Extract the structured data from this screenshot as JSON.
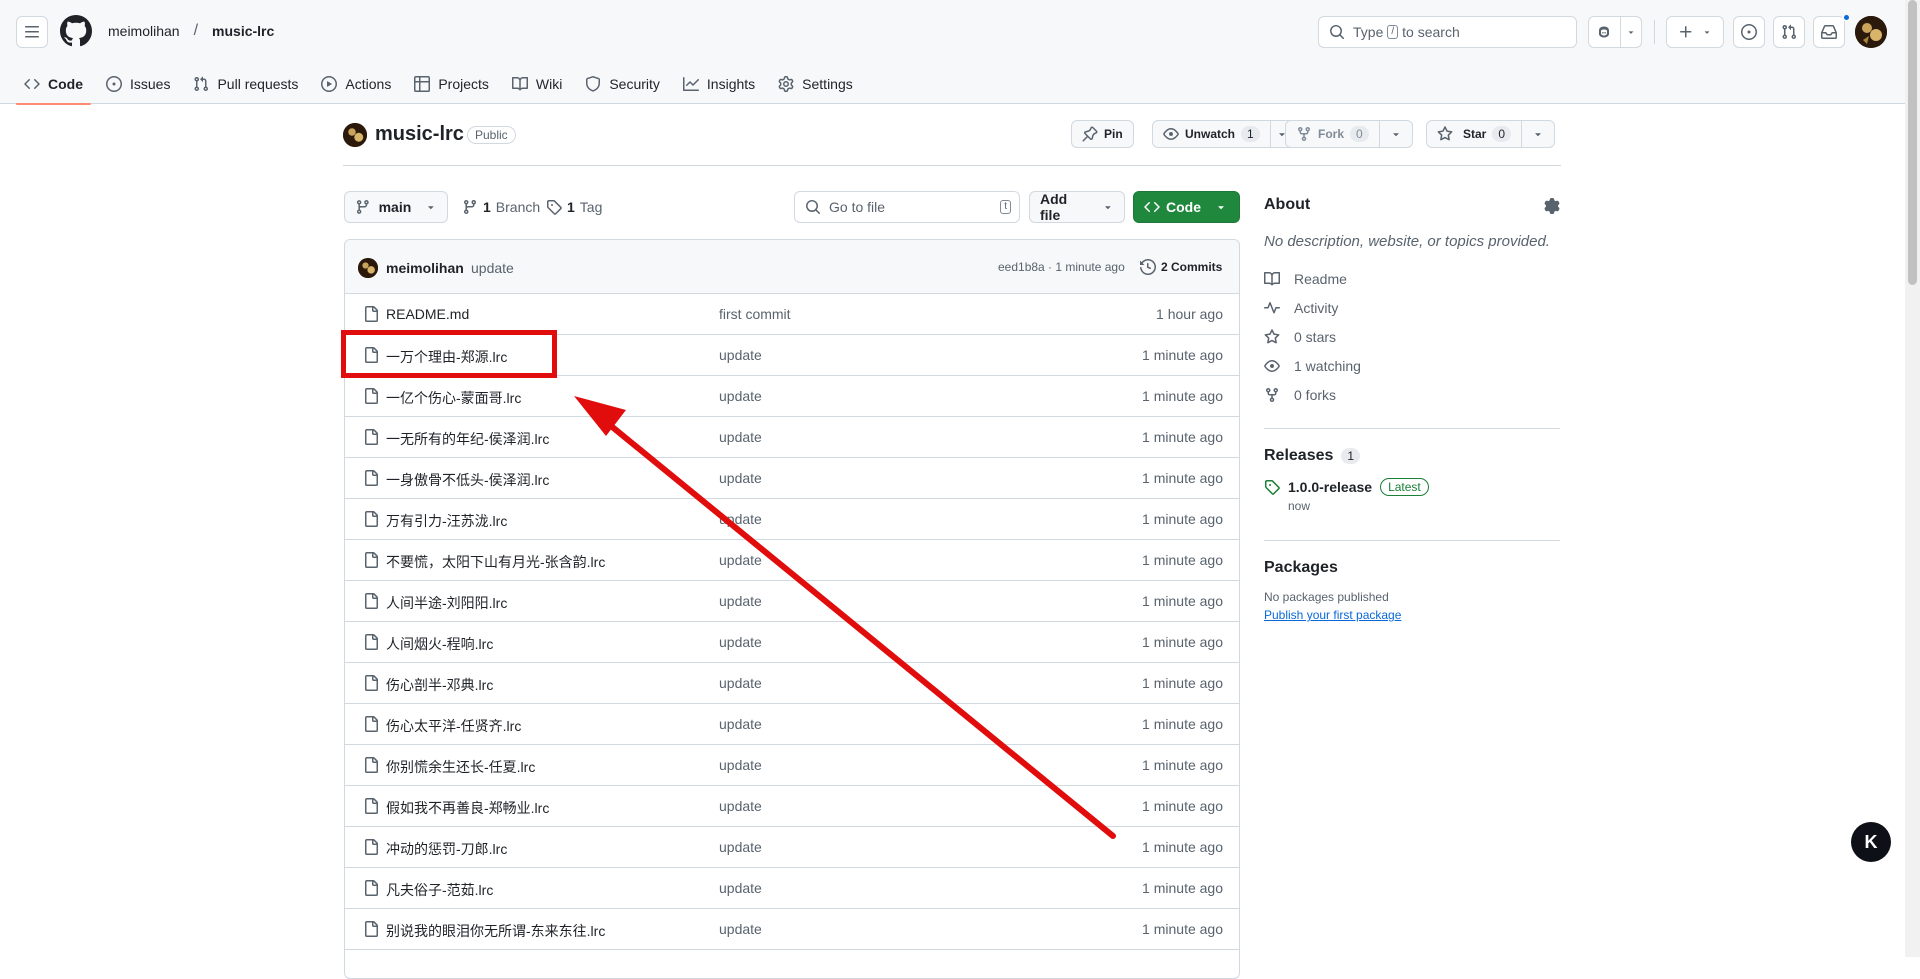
{
  "header": {
    "owner": "meimolihan",
    "separator": "/",
    "repo": "music-lrc",
    "search_prefix": "Type",
    "search_key": "/",
    "search_suffix": "to search"
  },
  "tabs": [
    {
      "label": "Code",
      "icon": "code-icon",
      "active": true
    },
    {
      "label": "Issues",
      "icon": "issue-icon"
    },
    {
      "label": "Pull requests",
      "icon": "pull-request-icon"
    },
    {
      "label": "Actions",
      "icon": "play-icon"
    },
    {
      "label": "Projects",
      "icon": "table-icon"
    },
    {
      "label": "Wiki",
      "icon": "book-icon"
    },
    {
      "label": "Security",
      "icon": "shield-icon"
    },
    {
      "label": "Insights",
      "icon": "graph-icon"
    },
    {
      "label": "Settings",
      "icon": "gear-icon"
    }
  ],
  "repo_head": {
    "title": "music-lrc",
    "visibility": "Public",
    "pin": "Pin",
    "unwatch": "Unwatch",
    "unwatch_count": "1",
    "fork": "Fork",
    "fork_count": "0",
    "star": "Star",
    "star_count": "0"
  },
  "toolbar": {
    "branch": "main",
    "branch_count": "1",
    "branch_label": "Branch",
    "tag_count": "1",
    "tag_label": "Tag",
    "goto_placeholder": "Go to file",
    "goto_key": "t",
    "add_file": "Add file",
    "code": "Code"
  },
  "commit": {
    "user": "meimolihan",
    "message": "update",
    "hash_time": "eed1b8a · 1 minute ago",
    "commits": "2 Commits"
  },
  "files": [
    {
      "name": "README.md",
      "message": "first commit",
      "time": "1 hour ago"
    },
    {
      "name": "一万个理由-郑源.lrc",
      "message": "update",
      "time": "1 minute ago"
    },
    {
      "name": "一亿个伤心-蒙面哥.lrc",
      "message": "update",
      "time": "1 minute ago"
    },
    {
      "name": "一无所有的年纪-侯泽润.lrc",
      "message": "update",
      "time": "1 minute ago"
    },
    {
      "name": "一身傲骨不低头-侯泽润.lrc",
      "message": "update",
      "time": "1 minute ago"
    },
    {
      "name": "万有引力-汪苏泷.lrc",
      "message": "update",
      "time": "1 minute ago"
    },
    {
      "name": "不要慌，太阳下山有月光-张含韵.lrc",
      "message": "update",
      "time": "1 minute ago"
    },
    {
      "name": "人间半途-刘阳阳.lrc",
      "message": "update",
      "time": "1 minute ago"
    },
    {
      "name": "人间烟火-程响.lrc",
      "message": "update",
      "time": "1 minute ago"
    },
    {
      "name": "伤心剖半-邓典.lrc",
      "message": "update",
      "time": "1 minute ago"
    },
    {
      "name": "伤心太平洋-任贤齐.lrc",
      "message": "update",
      "time": "1 minute ago"
    },
    {
      "name": "你别慌余生还长-任夏.lrc",
      "message": "update",
      "time": "1 minute ago"
    },
    {
      "name": "假如我不再善良-郑畅业.lrc",
      "message": "update",
      "time": "1 minute ago"
    },
    {
      "name": "冲动的惩罚-刀郎.lrc",
      "message": "update",
      "time": "1 minute ago"
    },
    {
      "name": "凡夫俗子-范茹.lrc",
      "message": "update",
      "time": "1 minute ago"
    },
    {
      "name": "别说我的眼泪你无所谓-东来东往.lrc",
      "message": "update",
      "time": "1 minute ago"
    }
  ],
  "about": {
    "title": "About",
    "description": "No description, website, or topics provided.",
    "readme": "Readme",
    "activity": "Activity",
    "stars": "0 stars",
    "watching": "1 watching",
    "forks": "0 forks"
  },
  "releases": {
    "title": "Releases",
    "count": "1",
    "tag": "1.0.0-release",
    "latest": "Latest",
    "when": "now"
  },
  "packages": {
    "title": "Packages",
    "none": "No packages published",
    "publish_link": "Publish your first package"
  },
  "annotation": {
    "color": "#e10d0d"
  },
  "colors": {
    "code_button": "#1f883d",
    "tab_underline": "#fd8c73",
    "link": "#0969da"
  }
}
